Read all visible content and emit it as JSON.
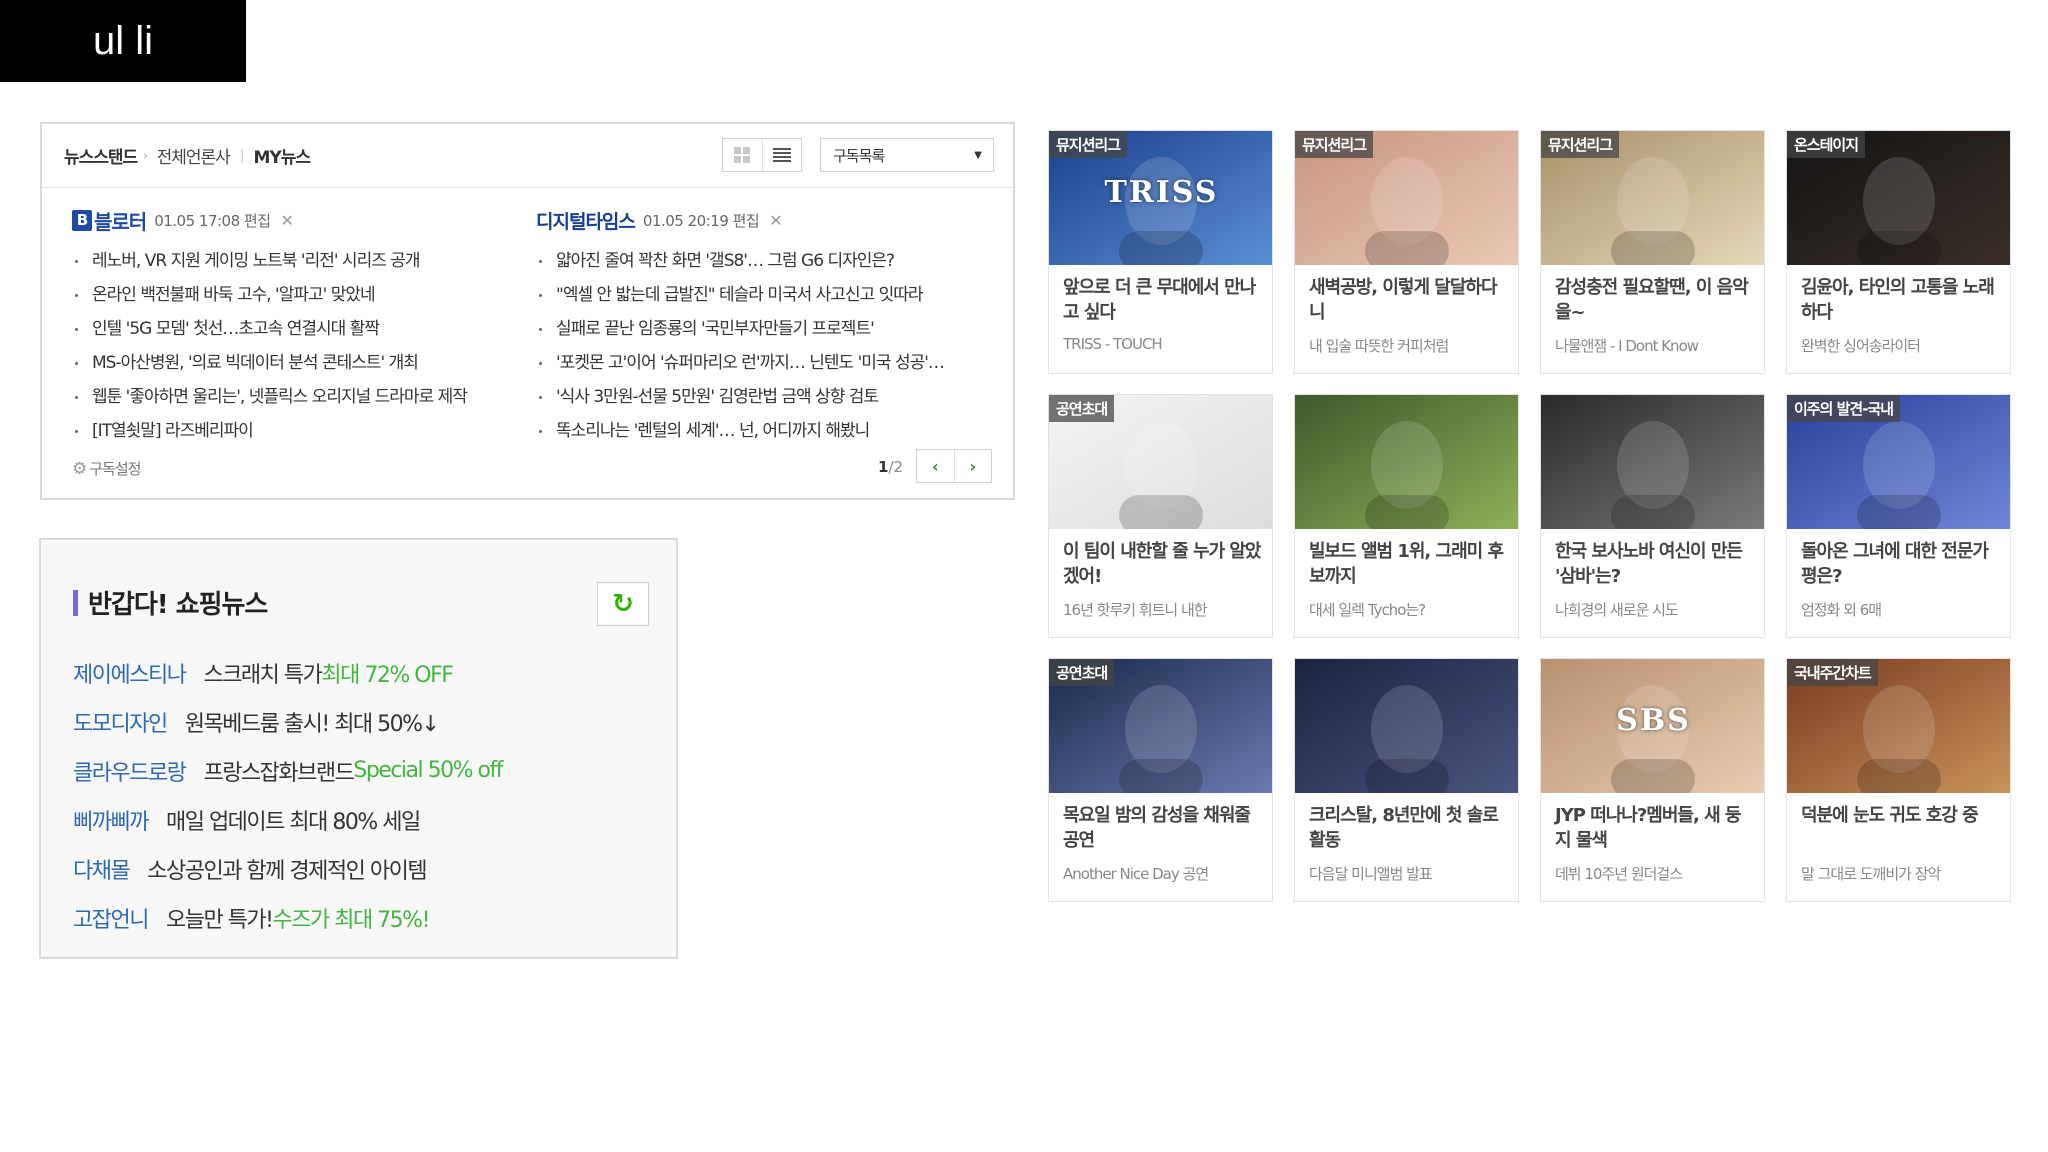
{
  "slide_label": "ul li",
  "newsstand": {
    "tabs": {
      "main": "뉴스스탠드",
      "all": "전체언론사",
      "my": "MY뉴스"
    },
    "select_value": "구독목록",
    "left": {
      "press_name": "블로터",
      "press_badge": "B",
      "edited": "01.05 17:08 편집",
      "items": [
        "레노버, VR 지원 게이밍 노트북 '리전' 시리즈 공개",
        "온라인 백전불패 바둑 고수, '알파고' 맞았네",
        "인텔 '5G 모뎀' 첫선…초고속 연결시대 활짝",
        "MS-아산병원, '의료 빅데이터 분석 콘테스트' 개최",
        "웹툰 '좋아하면 울리는', 넷플릭스 오리지널 드라마로 제작",
        "[IT열쇳말] 라즈베리파이"
      ]
    },
    "right": {
      "press_name": "디지털타임스",
      "edited": "01.05 20:19 편집",
      "items": [
        "얇아진 줄여 꽉찬 화면 '갤S8'… 그럼 G6 디자인은?",
        "\"엑셀 안 밟는데 급발진\" 테슬라 미국서 사고신고 잇따라",
        "실패로 끝난 임종룡의 '국민부자만들기 프로젝트'",
        "'포켓몬 고'이어 '슈퍼마리오 런'까지… 닌텐도 '미국 성공'…",
        "'식사 3만원-선물 5만원' 김영란법 금액 상향 검토",
        "똑소리나는 '렌털의 세계'… 넌, 어디까지 해봤니"
      ]
    },
    "settings_label": "구독설정",
    "page_current": "1",
    "page_total": "/2"
  },
  "shopping": {
    "title": "반갑다! 쇼핑뉴스",
    "items": [
      {
        "store": "제이에스티나",
        "desc": "스크래치 특가 ",
        "highlight": "최대 72% OFF"
      },
      {
        "store": "도모디자인",
        "desc": "원목베드룸 출시! 최대 50%↓",
        "highlight": ""
      },
      {
        "store": "클라우드로랑",
        "desc": "프랑스잡화브랜드 ",
        "highlight": "Special 50% off"
      },
      {
        "store": "삐까삐까",
        "desc": "매일 업데이트 최대 80% 세일",
        "highlight": ""
      },
      {
        "store": "다채몰",
        "desc": "소상공인과 함께 경제적인 아이템",
        "highlight": ""
      },
      {
        "store": "고잡언니",
        "desc": "오늘만 특가! ",
        "highlight": "수즈가 최대 75%!"
      }
    ]
  },
  "cards": [
    {
      "tag": "뮤지션리그",
      "title": "앞으로 더 큰 무대에서 만나고 싶다",
      "sub": "TRISS - TOUCH",
      "overlay": "TRISS",
      "colors": [
        "#1c3f8c",
        "#5b8fd6"
      ]
    },
    {
      "tag": "뮤지션리그",
      "title": "새벽공방, 이렇게 달달하다니",
      "sub": "내 입술 따뜻한 커피처럼",
      "overlay": "",
      "colors": [
        "#c99580",
        "#e8c9b5"
      ]
    },
    {
      "tag": "뮤지션리그",
      "title": "감성충전 필요할땐, 이 음악을~",
      "sub": "나물앤잼 - I Dont Know",
      "overlay": "",
      "colors": [
        "#a8916a",
        "#e6d8b8"
      ]
    },
    {
      "tag": "온스테이지",
      "title": "김윤아, 타인의 고통을 노래하다",
      "sub": "완벽한 싱어송라이터",
      "overlay": "",
      "colors": [
        "#141414",
        "#3a2e28"
      ]
    },
    {
      "tag": "공연초대",
      "title": "이 팀이 내한할 줄 누가 알았겠어!",
      "sub": "16년 핫루키 휘트니 내한",
      "overlay": "",
      "colors": [
        "#f4f4f4",
        "#dcdcdc"
      ]
    },
    {
      "tag": "",
      "title": "빌보드 앨범 1위, 그래미 후보까지",
      "sub": "대세 일렉 Tycho는?",
      "overlay": "",
      "colors": [
        "#3d5a2a",
        "#8fb05a"
      ]
    },
    {
      "tag": "",
      "title": "한국 보사노바 여신이 만든 '삼바'는?",
      "sub": "나희경의 새로운 시도",
      "overlay": "",
      "colors": [
        "#2a2a2a",
        "#7a7a7a"
      ]
    },
    {
      "tag": "이주의 발견-국내",
      "title": "돌아온 그녀에 대한 전문가 평은?",
      "sub": "엄정화 외 6매",
      "overlay": "",
      "colors": [
        "#2a3f9a",
        "#6f86d8"
      ]
    },
    {
      "tag": "공연초대",
      "title": "목요일 밤의 감성을 채워줄 공연",
      "sub": "Another Nice Day 공연",
      "overlay": "",
      "colors": [
        "#1a2a4a",
        "#6a7ab0"
      ]
    },
    {
      "tag": "",
      "title": "크리스탈, 8년만에 첫 솔로활동",
      "sub": "다음달 미니앨범 발표",
      "overlay": "",
      "colors": [
        "#1c2340",
        "#4a5580"
      ]
    },
    {
      "tag": "",
      "title": "JYP 떠나나?멤버들, 새 둥지 물색",
      "sub": "데뷔 10주년 원더걸스",
      "overlay": "SBS",
      "colors": [
        "#b89070",
        "#e8cdb0"
      ]
    },
    {
      "tag": "국내주간차트",
      "title": "덕분에 눈도 귀도 호강 중",
      "sub": "말 그대로 도깨비가 장악",
      "overlay": "",
      "colors": [
        "#7a3a20",
        "#c9935a"
      ]
    }
  ],
  "colors": {
    "link_blue": "#2e67b2",
    "highlight_green": "#44b640",
    "refresh_green": "#2db400",
    "accent_purple": "#7a6ad8"
  },
  "icons": {
    "grid_view": "grid-icon",
    "list_view": "list-icon",
    "settings": "gear-icon",
    "refresh": "refresh-icon",
    "prev": "chevron-left-icon",
    "next": "chevron-right-icon"
  }
}
